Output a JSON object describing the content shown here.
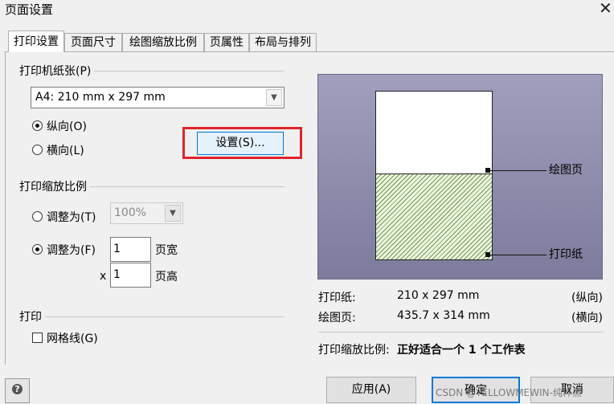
{
  "window": {
    "title": "页面设置",
    "close_glyph": "✕"
  },
  "tabs": [
    {
      "label": "打印设置",
      "active": true
    },
    {
      "label": "页面尺寸"
    },
    {
      "label": "绘图缩放比例"
    },
    {
      "label": "页属性"
    },
    {
      "label": "布局与排列"
    }
  ],
  "printer_paper": {
    "section": "打印机纸张(P)",
    "paper_value": "A4:  210 mm x 297 mm",
    "portrait_label": "纵向(O)",
    "landscape_label": "横向(L)",
    "orientation_selected": "portrait",
    "setup_button": "设置(S)...",
    "highlight_color": "#e0242b"
  },
  "print_zoom": {
    "section": "打印缩放比例",
    "adjust_to_label": "调整为(T)",
    "adjust_percent": "100%",
    "fit_to_label": "调整为(F)",
    "fit_selected": true,
    "pages_wide": "1",
    "pages_wide_label": "页宽",
    "times": "x",
    "pages_high": "1",
    "pages_high_label": "页高"
  },
  "print": {
    "section": "打印",
    "gridlines_label": "网格线(G)",
    "gridlines_checked": false
  },
  "preview": {
    "drawing_page_label": "绘图页",
    "printer_paper_label": "打印纸"
  },
  "info": {
    "paper_label": "打印纸:",
    "paper_size": "210 x 297 mm",
    "paper_orientation": "(纵向)",
    "drawing_label": "绘图页:",
    "drawing_size": "435.7 x 314 mm",
    "drawing_orientation": "(横向)",
    "zoom_label": "打印缩放比例:",
    "zoom_value": "正好适合一个 1 个工作表"
  },
  "footer": {
    "help_glyph": "?",
    "apply": "应用(A)",
    "ok": "确定",
    "cancel": "取消",
    "watermark": "CSDN @YELLOWMEWIN-纯粹黑"
  }
}
